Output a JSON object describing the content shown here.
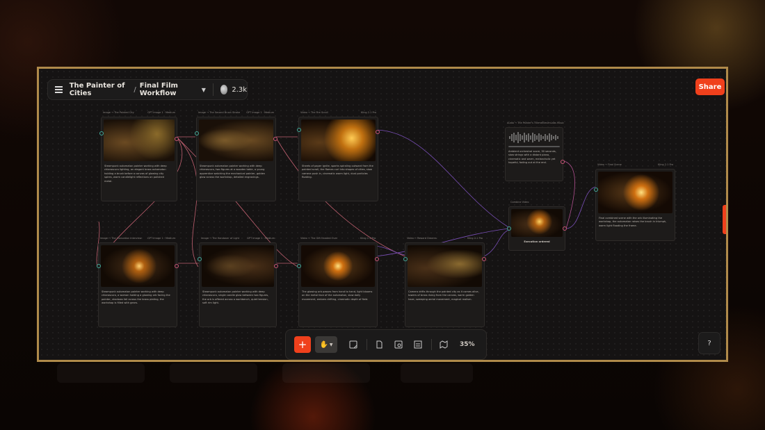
{
  "project": {
    "name": "The Painter of Cities",
    "separator": "/",
    "workflow": "Final Film Workflow",
    "views": "2.3k"
  },
  "share_label": "Share",
  "help_label": "?",
  "zoom_level": "35%",
  "colors": {
    "accent": "#f0401c",
    "frame": "#b08a4a",
    "canvas": "#151313"
  },
  "nodes": [
    {
      "id": "n1",
      "title": "Image → The Painted City",
      "model": "GPT Image 1 · Medium",
      "text": "Steampunk automaton painter working with deep chiaroscuro lighting, an elegant brass automaton holding a brush before a canvas of glowing city spires, warm candlelight reflections on polished metal."
    },
    {
      "id": "n2",
      "title": "Image → The Second Brush Stroke",
      "model": "GPT Image 1 · Medium",
      "text": "Steampunk automaton painter working with deep chiaroscuro, two figures at a wooden table, a young apprentice watching the mechanical painter, golden glow across the workshop, detailed engravings."
    },
    {
      "id": "n3",
      "title": "Video → The Fire Scroll",
      "model": "Kling 2.1 Pro",
      "text": "Sheets of paper ignite, sparks spiraling outward from the painted scroll, the flames curl into shapes of cities, slow camera push in, cinematic warm light, dust particles floating."
    },
    {
      "id": "n4",
      "title": "Image → The Innovation Interview",
      "model": "GPT Image 1 · Medium",
      "text": "Steampunk automaton painter working with deep chiaroscuro, a woman holding a glowing orb facing the painter, shadows fall across the brass plating, the workshop is filled with gears."
    },
    {
      "id": "n5",
      "title": "Image → The Handover of Light",
      "model": "GPT Image 1 · Medium",
      "text": "Steampunk automaton painter working with deep chiaroscuro, single candle glow between two figures, the orb is offered across a workbench, quiet tension, soft rim light."
    },
    {
      "id": "n6",
      "title": "Video → The Gift Handed Over",
      "model": "Kling 2.1 Pro",
      "text": "The glowing orb passes from hand to hand, light blooms on the metal face of the automaton, slow dolly movement, embers drifting, cinematic depth of field."
    },
    {
      "id": "n7",
      "title": "Video → Reward Dreams",
      "model": "Kling 2.1 Pro",
      "text": "Camera drifts through the painted city as it comes alive, towers of brass rising from the canvas, warm golden haze, sweeping aerial movement, magical realism."
    },
    {
      "id": "n8",
      "title": "Audio → The Painter's Theme",
      "model": "ElevenLabs Music",
      "text": "Ambient orchestral score, 30 seconds, slow strings with a distant piano, cinematic and warm, melancholic yet hopeful, fading out at the end."
    },
    {
      "id": "n9",
      "title": "Combine Video",
      "model": "",
      "tag": "Execution ordered",
      "text": ""
    },
    {
      "id": "n10",
      "title": "Video → Final Scene",
      "model": "Kling 2.1 Pro",
      "text": "Final combined scene with the orb illuminating the workshop, the automaton raises the brush in triumph, warm light flooding the frame."
    }
  ]
}
